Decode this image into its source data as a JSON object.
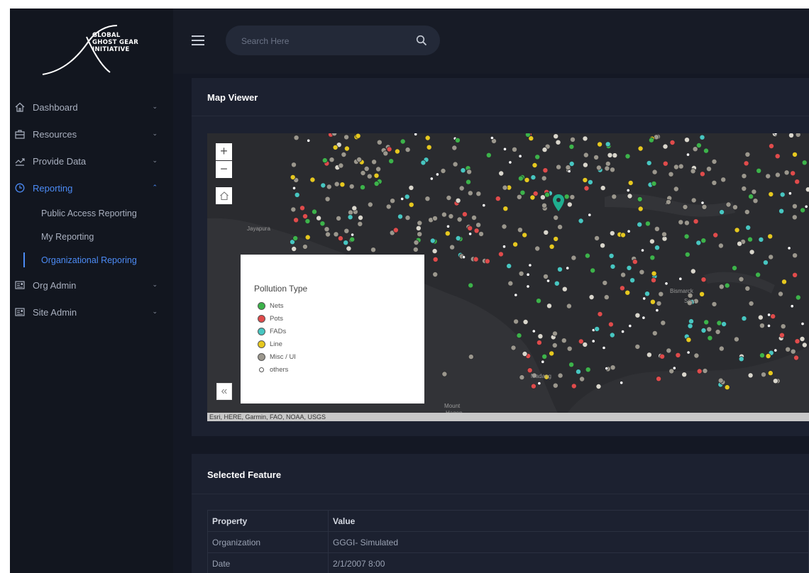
{
  "logo": {
    "line1": "GLOBAL",
    "line2": "GHOST GEAR",
    "line3": "INITIATIVE"
  },
  "sidebar": {
    "items": [
      {
        "label": "Dashboard",
        "icon": "home-icon"
      },
      {
        "label": "Resources",
        "icon": "briefcase-icon"
      },
      {
        "label": "Provide Data",
        "icon": "trend-icon"
      },
      {
        "label": "Reporting",
        "icon": "clock-icon",
        "expanded": true
      },
      {
        "label": "Org Admin",
        "icon": "id-card-icon"
      },
      {
        "label": "Site Admin",
        "icon": "id-card-icon"
      }
    ],
    "reporting_sub": [
      {
        "label": "Public Access Reporting"
      },
      {
        "label": "My Reporting"
      },
      {
        "label": "Organizational Reporing",
        "active": true
      }
    ]
  },
  "search": {
    "placeholder": "Search Here"
  },
  "map_card": {
    "title": "Map Viewer",
    "attribution": "Esri, HERE, Garmin, FAO, NOAA, USGS",
    "places": {
      "jayapura": "Jayapura",
      "madang": "Madang",
      "mount": "Mount",
      "hagen": "Hagen",
      "bismarck": "Bismarck",
      "sea": "Sea"
    },
    "legend": {
      "title": "Pollution Type",
      "items": [
        {
          "label": "Nets",
          "color": "#3cb34a"
        },
        {
          "label": "Pots",
          "color": "#e04b4b"
        },
        {
          "label": "FADs",
          "color": "#47c6c1"
        },
        {
          "label": "Line",
          "color": "#e6c81f"
        },
        {
          "label": "Misc / UI",
          "color": "#9b978d"
        },
        {
          "label": "others",
          "color": "#ffffff"
        }
      ]
    }
  },
  "feature_card": {
    "title": "Selected Feature",
    "headers": [
      "Property",
      "Value"
    ],
    "rows": [
      [
        "Organization",
        "GGGI- Simulated"
      ],
      [
        "Date",
        "2/1/2007 8:00"
      ]
    ]
  },
  "colors": {
    "accent": "#4c8bf5",
    "marker": "#1fae8f"
  }
}
